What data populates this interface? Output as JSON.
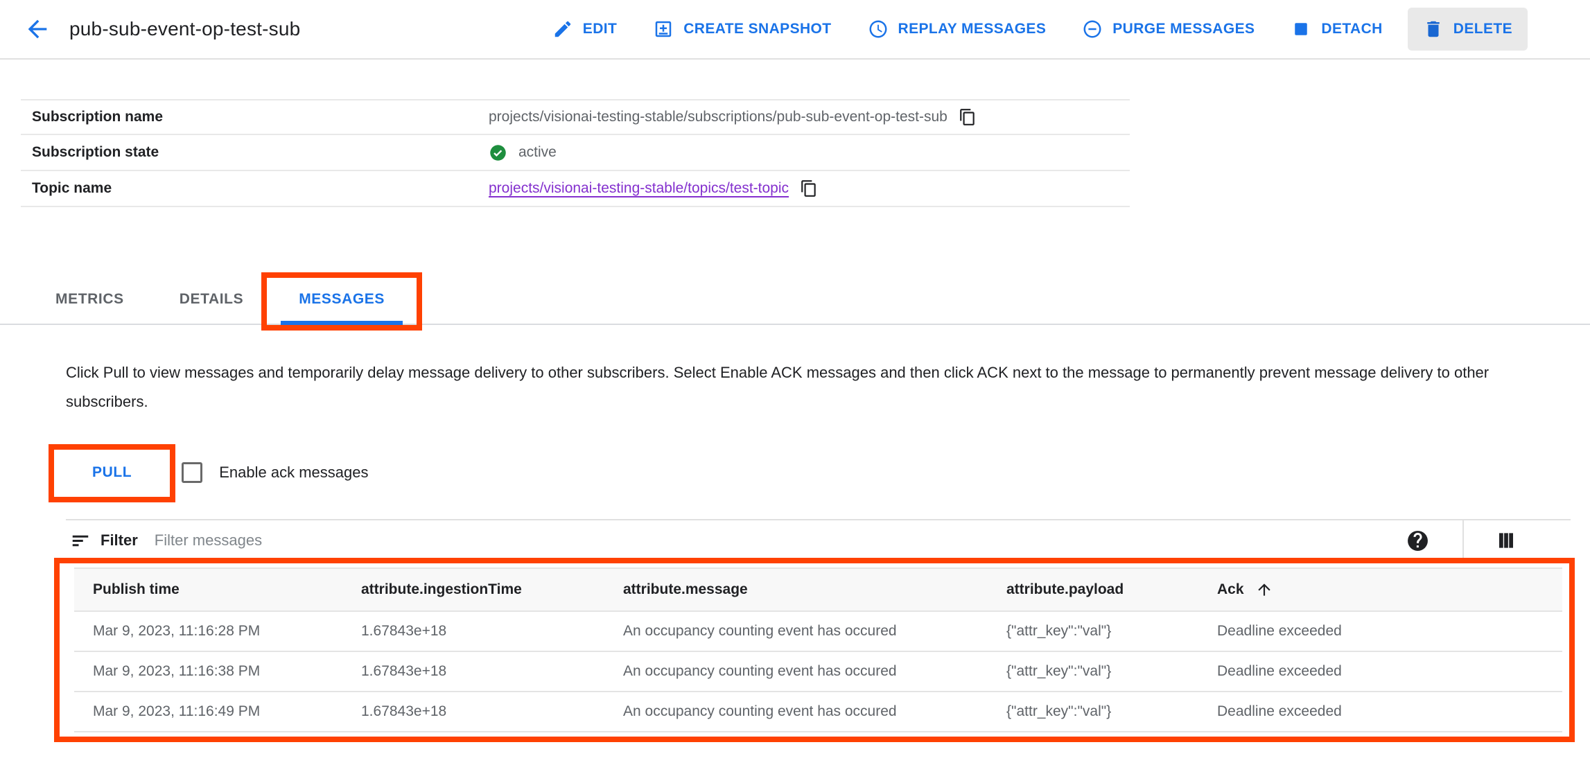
{
  "colors": {
    "accent": "#1a73e8",
    "annotation": "#ff4102",
    "visited_link": "#8430ce",
    "status_active_green": "#1e8e3e"
  },
  "header": {
    "back_icon": "arrow-left",
    "title": "pub-sub-event-op-test-sub",
    "actions": [
      {
        "label": "EDIT",
        "icon": "pencil-icon"
      },
      {
        "label": "CREATE SNAPSHOT",
        "icon": "snapshot-icon"
      },
      {
        "label": "REPLAY MESSAGES",
        "icon": "clock-icon"
      },
      {
        "label": "PURGE MESSAGES",
        "icon": "minus-circle-icon"
      },
      {
        "label": "DETACH",
        "icon": "detach-icon"
      },
      {
        "label": "DELETE",
        "icon": "trash-icon"
      }
    ]
  },
  "details": {
    "rows": [
      {
        "label": "Subscription name",
        "value": "projects/visionai-testing-stable/subscriptions/pub-sub-event-op-test-sub",
        "trailing_icon": "copy-icon"
      },
      {
        "label": "Subscription state",
        "value": "active",
        "leading_icon": "check-circle-icon"
      },
      {
        "label": "Topic name",
        "value": "projects/visionai-testing-stable/topics/test-topic",
        "trailing_icon": "copy-icon",
        "is_link": true
      }
    ]
  },
  "tabs": [
    {
      "label": "METRICS",
      "active": false
    },
    {
      "label": "DETAILS",
      "active": false
    },
    {
      "label": "MESSAGES",
      "active": true,
      "annotated": true
    }
  ],
  "messages": {
    "description": "Click Pull to view messages and temporarily delay message delivery to other subscribers. Select Enable ACK messages and then click ACK next to the message to permanently prevent message delivery to other subscribers.",
    "pull_button_label": "PULL",
    "ack_checkbox": {
      "label": "Enable ack messages",
      "checked": false
    },
    "filter": {
      "leading_icon": "filter-list-icon",
      "label": "Filter",
      "placeholder": "Filter messages",
      "help_icon": "question-circle-icon",
      "columns_icon": "column-selector-icon"
    },
    "table": {
      "columns": [
        "Publish time",
        "attribute.ingestionTime",
        "attribute.message",
        "attribute.payload",
        "Ack"
      ],
      "sort": {
        "column": "Ack",
        "direction": "ascending",
        "icon": "arrow-up-icon"
      },
      "rows": [
        [
          "Mar 9, 2023, 11:16:28 PM",
          "1.67843e+18",
          "An occupancy counting event has occured",
          "{\"attr_key\":\"val\"}",
          "Deadline exceeded"
        ],
        [
          "Mar 9, 2023, 11:16:38 PM",
          "1.67843e+18",
          "An occupancy counting event has occured",
          "{\"attr_key\":\"val\"}",
          "Deadline exceeded"
        ],
        [
          "Mar 9, 2023, 11:16:49 PM",
          "1.67843e+18",
          "An occupancy counting event has occured",
          "{\"attr_key\":\"val\"}",
          "Deadline exceeded"
        ]
      ]
    }
  }
}
